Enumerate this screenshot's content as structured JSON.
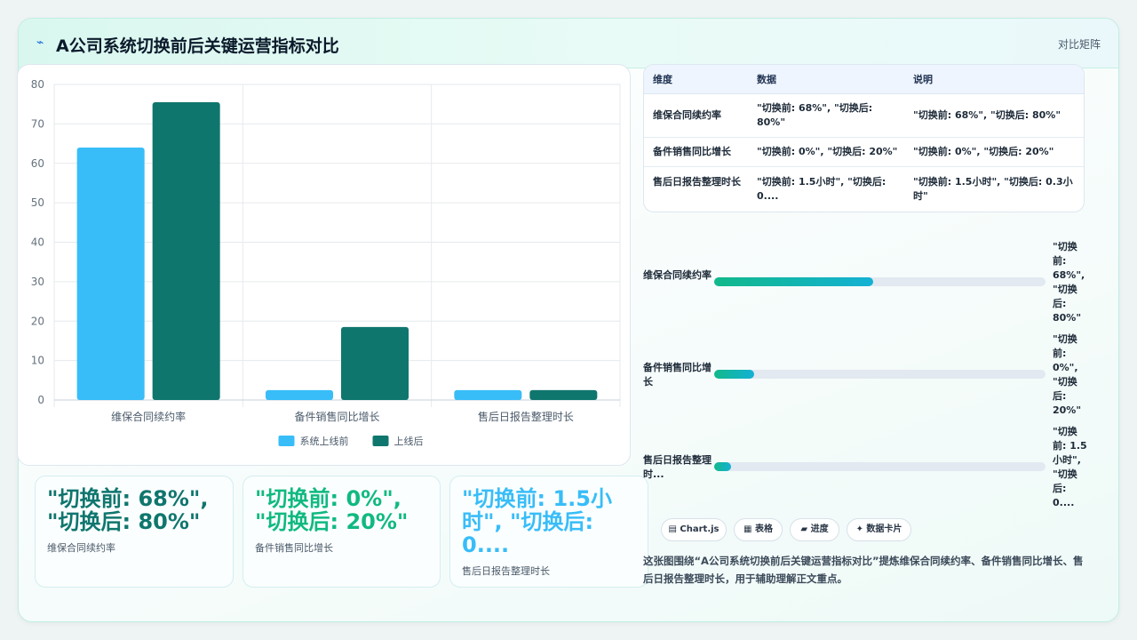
{
  "header": {
    "title": "A公司系统切换前后关键运营指标对比",
    "right_label": "对比矩阵",
    "icon": "lightning-icon"
  },
  "chart_data": {
    "type": "bar",
    "categories": [
      "维保合同续约率",
      "备件销售同比增长",
      "售后日报告整理时长"
    ],
    "series": [
      {
        "name": "系统上线前",
        "values": [
          64,
          2.5,
          2.5
        ],
        "color": "#38bdf8"
      },
      {
        "name": "上线后",
        "values": [
          75.5,
          18.5,
          2.5
        ],
        "color": "#0f766e"
      }
    ],
    "ylim": [
      0,
      80
    ],
    "yticks": [
      0,
      10,
      20,
      30,
      40,
      50,
      60,
      70,
      80
    ],
    "grid": true,
    "legend": "bottom"
  },
  "cards": [
    {
      "value": "\"切换前: 68%\", \"切换后: 80%\"",
      "label": "维保合同续约率",
      "color": "#0f766e"
    },
    {
      "value": "\"切换前: 0%\", \"切换后: 20%\"",
      "label": "备件销售同比增长",
      "color": "#10b981"
    },
    {
      "value": "\"切换前: 1.5小时\", \"切换后: 0....",
      "label": "售后日报告整理时长",
      "color": "#38bdf8"
    }
  ],
  "table": {
    "headers": [
      "维度",
      "数据",
      "说明"
    ],
    "rows": [
      [
        "维保合同续约率",
        "\"切换前: 68%\", \"切换后: 80%\"",
        "\"切换前: 68%\", \"切换后: 80%\""
      ],
      [
        "备件销售同比增长",
        "\"切换前: 0%\", \"切换后: 20%\"",
        "\"切换前: 0%\", \"切换后: 20%\""
      ],
      [
        "售后日报告整理时长",
        "\"切换前: 1.5小时\", \"切换后: 0....",
        "\"切换前: 1.5小时\", \"切换后: 0.3小时\""
      ]
    ]
  },
  "progress": [
    {
      "label": "维保合同续约率",
      "value": "\"切换前: 68%\", \"切换后: 80%\"",
      "fraction": 0.48
    },
    {
      "label": "备件销售同比增长",
      "value": "\"切换前: 0%\", \"切换后: 20%\"",
      "fraction": 0.12
    },
    {
      "label": "售后日报告整理时...",
      "value": "\"切换前: 1.5小时\", \"切换后: 0....",
      "fraction": 0.05
    }
  ],
  "chips": [
    "▤ Chart.js",
    "▦ 表格",
    "▰ 进度",
    "✦ 数据卡片"
  ],
  "note": "这张图围绕“A公司系统切换前后关键运营指标对比”提炼维保合同续约率、备件销售同比增长、售后日报告整理时长，用于辅助理解正文重点。"
}
